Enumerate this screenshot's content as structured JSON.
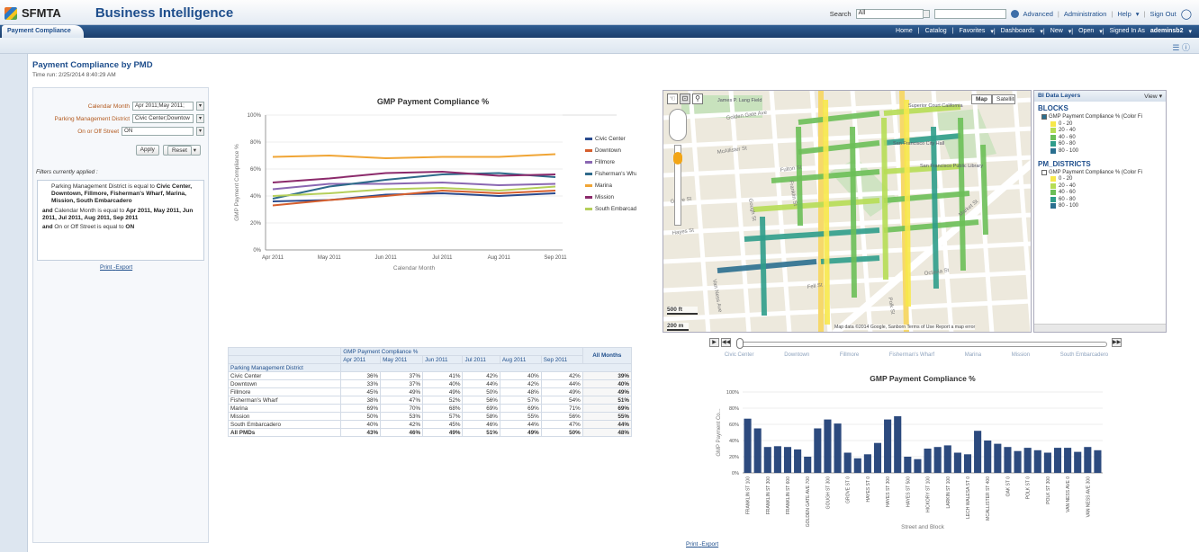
{
  "header": {
    "brand": "SFMTA",
    "app_title": "Business Intelligence",
    "search_label": "Search",
    "search_scope": "All",
    "links": [
      "Advanced",
      "Administration",
      "Help",
      "Sign Out"
    ]
  },
  "nav": {
    "tab": "Payment Compliance",
    "links": [
      "Home",
      "Catalog",
      "Favorites",
      "Dashboards",
      "New",
      "Open",
      "Signed In As"
    ],
    "user": "ademinsb2"
  },
  "page": {
    "title": "Payment Compliance by PMD",
    "time_run": "Time run: 2/25/2014 8:40:29 AM"
  },
  "prompts": {
    "calendar_label": "Calendar Month",
    "calendar_value": "Apr 2011;May 2011;",
    "district_label": "Parking Management District",
    "district_value": "Civic Center;Downtow",
    "street_label": "On or Off Street",
    "street_value": "ON",
    "apply": "Apply",
    "reset": "Reset",
    "filters_caption": "Filters currently applied :",
    "filter1_pre": "Parking Management District is equal to ",
    "filter1_vals": "Civic Center, Downtown, Fillmore, Fisherman's Wharf, Marina, Mission, South Embarcadero",
    "and1": "and",
    "filter2_pre": "Calendar Month is equal to ",
    "filter2_vals": "Apr 2011, May 2011, Jun 2011, Jul 2011, Aug 2011, Sep 2011",
    "and2": "and",
    "filter3_pre": "On or Off Street is equal to ",
    "filter3_vals": "ON",
    "print": "Print",
    "export": "Export"
  },
  "table": {
    "group_header": "GMP Payment Compliance %",
    "all_months": "All Months",
    "row_header": "Parking Management District",
    "months": [
      "Apr 2011",
      "May 2011",
      "Jun 2011",
      "Jul 2011",
      "Aug 2011",
      "Sep 2011"
    ],
    "rows": [
      {
        "name": "Civic Center",
        "vals": [
          "36%",
          "37%",
          "41%",
          "42%",
          "40%",
          "42%"
        ],
        "all": "39%"
      },
      {
        "name": "Downtown",
        "vals": [
          "33%",
          "37%",
          "40%",
          "44%",
          "42%",
          "44%"
        ],
        "all": "40%"
      },
      {
        "name": "Fillmore",
        "vals": [
          "45%",
          "49%",
          "49%",
          "50%",
          "48%",
          "49%"
        ],
        "all": "49%"
      },
      {
        "name": "Fisherman's Wharf",
        "vals": [
          "38%",
          "47%",
          "52%",
          "56%",
          "57%",
          "54%"
        ],
        "all": "51%"
      },
      {
        "name": "Marina",
        "vals": [
          "69%",
          "70%",
          "68%",
          "69%",
          "69%",
          "71%"
        ],
        "all": "69%"
      },
      {
        "name": "Mission",
        "vals": [
          "50%",
          "53%",
          "57%",
          "58%",
          "55%",
          "56%"
        ],
        "all": "55%"
      },
      {
        "name": "South Embarcadero",
        "vals": [
          "40%",
          "42%",
          "45%",
          "46%",
          "44%",
          "47%"
        ],
        "all": "44%"
      }
    ],
    "total": {
      "name": "All PMDs",
      "vals": [
        "43%",
        "46%",
        "49%",
        "51%",
        "49%",
        "50%"
      ],
      "all": "48%"
    }
  },
  "map": {
    "streets": [
      "Golden Gate Ave",
      "McAllister St",
      "Fulton St",
      "Grove St",
      "Hayes St",
      "Fell St",
      "Market St",
      "Octavia St",
      "Gough St",
      "Franklin St",
      "Van Ness Ave",
      "Polk St",
      "Larkin St",
      "Hyde St",
      "Ivy St",
      "Linden St"
    ],
    "places": [
      "James P. Lang Field",
      "Superior Court California",
      "San Francisco City Hall",
      "San Francisco Public Library"
    ],
    "map_btn": "Map",
    "sat_btn": "Satellite",
    "scale1": "500 ft",
    "scale2": "200 m",
    "footer": "Map data ©2014 Google, Sanborn   Terms of Use   Report a map error"
  },
  "layers": {
    "title": "BI Data Layers",
    "view": "View",
    "sec1": "BLOCKS",
    "sec1_item": "GMP Payment Compliance % (Color Fi",
    "sec2": "PM_DISTRICTS",
    "sec2_item": "GMP Payment Compliance % (Color Fi",
    "legend": [
      {
        "label": "0 - 20",
        "color": "#f7e84a"
      },
      {
        "label": "20 - 40",
        "color": "#b6dd55"
      },
      {
        "label": "40 - 60",
        "color": "#6cbf58"
      },
      {
        "label": "60 - 80",
        "color": "#2f9d8b"
      },
      {
        "label": "80 - 100",
        "color": "#2a6f8f"
      }
    ]
  },
  "slider": {
    "labels": [
      "Civic Center",
      "Downtown",
      "Fillmore",
      "Fisherman's Wharf",
      "Marina",
      "Mission",
      "South Embarcadero"
    ]
  },
  "links2": {
    "print": "Print",
    "export": "Export"
  },
  "chart_data": [
    {
      "type": "line",
      "title": "GMP Payment Compliance %",
      "xlabel": "Calendar Month",
      "ylabel": "GMP Payment Compliance %",
      "categories": [
        "Apr 2011",
        "May 2011",
        "Jun 2011",
        "Jul 2011",
        "Aug 2011",
        "Sep 2011"
      ],
      "yticks": [
        "0%",
        "20%",
        "40%",
        "60%",
        "80%",
        "100%"
      ],
      "ylim": [
        0,
        100
      ],
      "legend": "right",
      "series": [
        {
          "name": "Civic Center",
          "color": "#2b4b8e",
          "values": [
            36,
            37,
            41,
            42,
            40,
            42
          ]
        },
        {
          "name": "Downtown",
          "color": "#d65f2d",
          "values": [
            33,
            37,
            40,
            44,
            42,
            44
          ]
        },
        {
          "name": "Fillmore",
          "color": "#8a67b2",
          "values": [
            45,
            49,
            49,
            50,
            48,
            49
          ]
        },
        {
          "name": "Fisherman's Wharf",
          "color": "#2e6a8a",
          "values": [
            38,
            47,
            52,
            56,
            57,
            54
          ]
        },
        {
          "name": "Marina",
          "color": "#f0a535",
          "values": [
            69,
            70,
            68,
            69,
            69,
            71
          ]
        },
        {
          "name": "Mission",
          "color": "#8b2a6b",
          "values": [
            50,
            53,
            57,
            58,
            55,
            56
          ]
        },
        {
          "name": "South Embarcadero",
          "color": "#b5cf5a",
          "values": [
            40,
            42,
            45,
            46,
            44,
            47
          ]
        }
      ]
    },
    {
      "type": "bar",
      "title": "GMP Payment Compliance %",
      "xlabel": "Street and Block",
      "ylabel": "GMP Payment Co...",
      "ylim": [
        0,
        100
      ],
      "yticks": [
        "0%",
        "20%",
        "40%",
        "60%",
        "80%",
        "100%"
      ],
      "color": "#2c4a7e",
      "categories": [
        "FRANKLIN ST 100",
        "",
        "FRANKLIN ST 300",
        "",
        "FRANKLIN ST 600",
        "",
        "GOLDEN GATE AVE 700",
        "",
        "GOUGH ST 300",
        "",
        "GROVE ST 0",
        "",
        "HAYES ST 0",
        "",
        "HAYES ST 300",
        "",
        "HAYES ST 500",
        "",
        "HICKORY ST 100",
        "",
        "LARKIN ST 100",
        "",
        "LECH WALESA ST 0",
        "",
        "MCALLISTER ST 400",
        "",
        "OAK ST 0",
        "",
        "POLK ST 0",
        "",
        "POLK ST 300",
        "",
        "VAN NESS AVE 0",
        "",
        "VAN NESS AVE 300",
        "",
        "VAN NESS AVE 500",
        ""
      ],
      "values": [
        67,
        55,
        32,
        33,
        32,
        29,
        20,
        55,
        66,
        61,
        25,
        18,
        23,
        37,
        66,
        70,
        20,
        17,
        30,
        32,
        34,
        25,
        23,
        52,
        40,
        36,
        32,
        27,
        31,
        28,
        25,
        31,
        31,
        26,
        32,
        28
      ]
    }
  ]
}
